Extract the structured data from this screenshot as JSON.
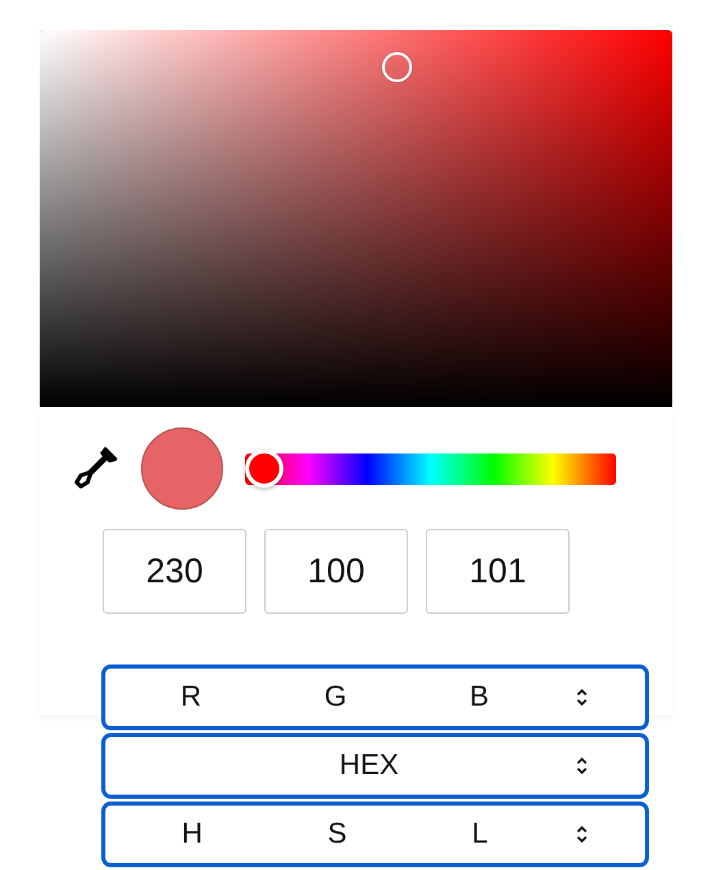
{
  "color_swatch": {
    "color": "#e66465"
  },
  "hue_slider": {
    "level": 0
  },
  "channel_values": [
    "230",
    "100",
    "101"
  ],
  "format_options": [
    {
      "labels": [
        "R",
        "G",
        "B"
      ]
    },
    {
      "labels": [
        "HEX"
      ]
    },
    {
      "labels": [
        "H",
        "S",
        "L"
      ]
    }
  ]
}
